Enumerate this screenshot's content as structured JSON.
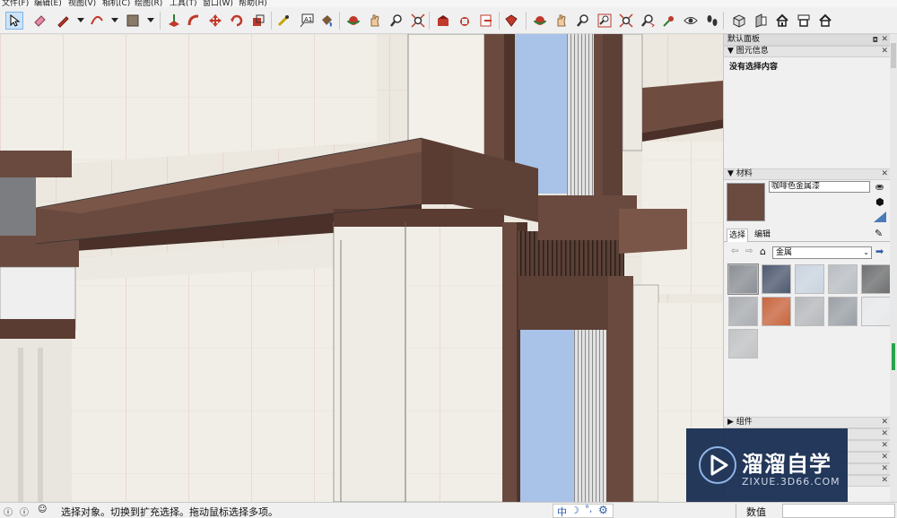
{
  "menu": [
    {
      "label": "文件(F)"
    },
    {
      "label": "编辑(E)"
    },
    {
      "label": "视图(V)"
    },
    {
      "label": "相机(C)"
    },
    {
      "label": "绘图(R)"
    },
    {
      "label": "工具(T)"
    },
    {
      "label": "窗口(W)"
    },
    {
      "label": "帮助(H)"
    }
  ],
  "toolbar": {
    "icons": [
      "select-icon",
      "eraser-icon",
      "pencil-icon",
      "arc-icon",
      "shape-icon",
      "push-pull-icon",
      "follow-me-icon",
      "move-icon",
      "rotate-icon",
      "scale-icon",
      "tape-measure-icon",
      "text-icon",
      "paint-bucket-icon",
      "orbit-icon",
      "pan-icon",
      "zoom-icon",
      "zoom-extents-icon",
      "warehouse-icon",
      "components-icon",
      "send-to-layout-icon",
      "ruby-icon",
      "orbit2-icon",
      "pan2-icon",
      "zoom2-icon",
      "zoom-window-icon",
      "zoom-extents2-icon",
      "previous-view-icon",
      "position-camera-icon",
      "look-around-icon",
      "walk-icon",
      "iso-view-icon",
      "right-view-icon",
      "top-view-icon",
      "front-view-icon",
      "home-view-icon"
    ]
  },
  "panel": {
    "tray_title": "默认面板",
    "entity_info": {
      "header": "图元信息",
      "status": "没有选择内容"
    },
    "materials": {
      "header": "材料",
      "material_name": "咖啡色金属漆",
      "swatch_color": "#6b4a3f",
      "tabs": [
        "选择",
        "编辑"
      ],
      "library": "金属",
      "swatches": [
        {
          "color": "#8a8f95",
          "icon": "metal-pattern"
        },
        {
          "color": "#4e5a70",
          "icon": "metal-pattern"
        },
        {
          "color": "#c9d3df",
          "icon": "metal-pattern"
        },
        {
          "color": "#b8bdc2",
          "icon": "metal-pattern"
        },
        {
          "color": "#6e6f70",
          "icon": "metal-pattern"
        },
        {
          "color": "#a9acb0",
          "icon": "metal-pattern"
        },
        {
          "color": "#c8653f",
          "icon": "metal-pattern"
        },
        {
          "color": "#b5b8bb",
          "icon": "metal-pattern"
        },
        {
          "color": "#9aa0a6",
          "icon": "metal-pattern"
        },
        {
          "color": "#e6e8ea",
          "icon": "metal-pattern"
        },
        {
          "color": "#c0c2c4",
          "icon": "metal-pattern"
        }
      ]
    },
    "components": {
      "header": "组件"
    }
  },
  "status": {
    "message": "选择对象。切换到扩充选择。拖动鼠标选择多项。",
    "ime": "中",
    "value_label": "数值"
  },
  "watermark": {
    "title": "溜溜自学",
    "url": "ZIXUE.3D66.COM"
  }
}
